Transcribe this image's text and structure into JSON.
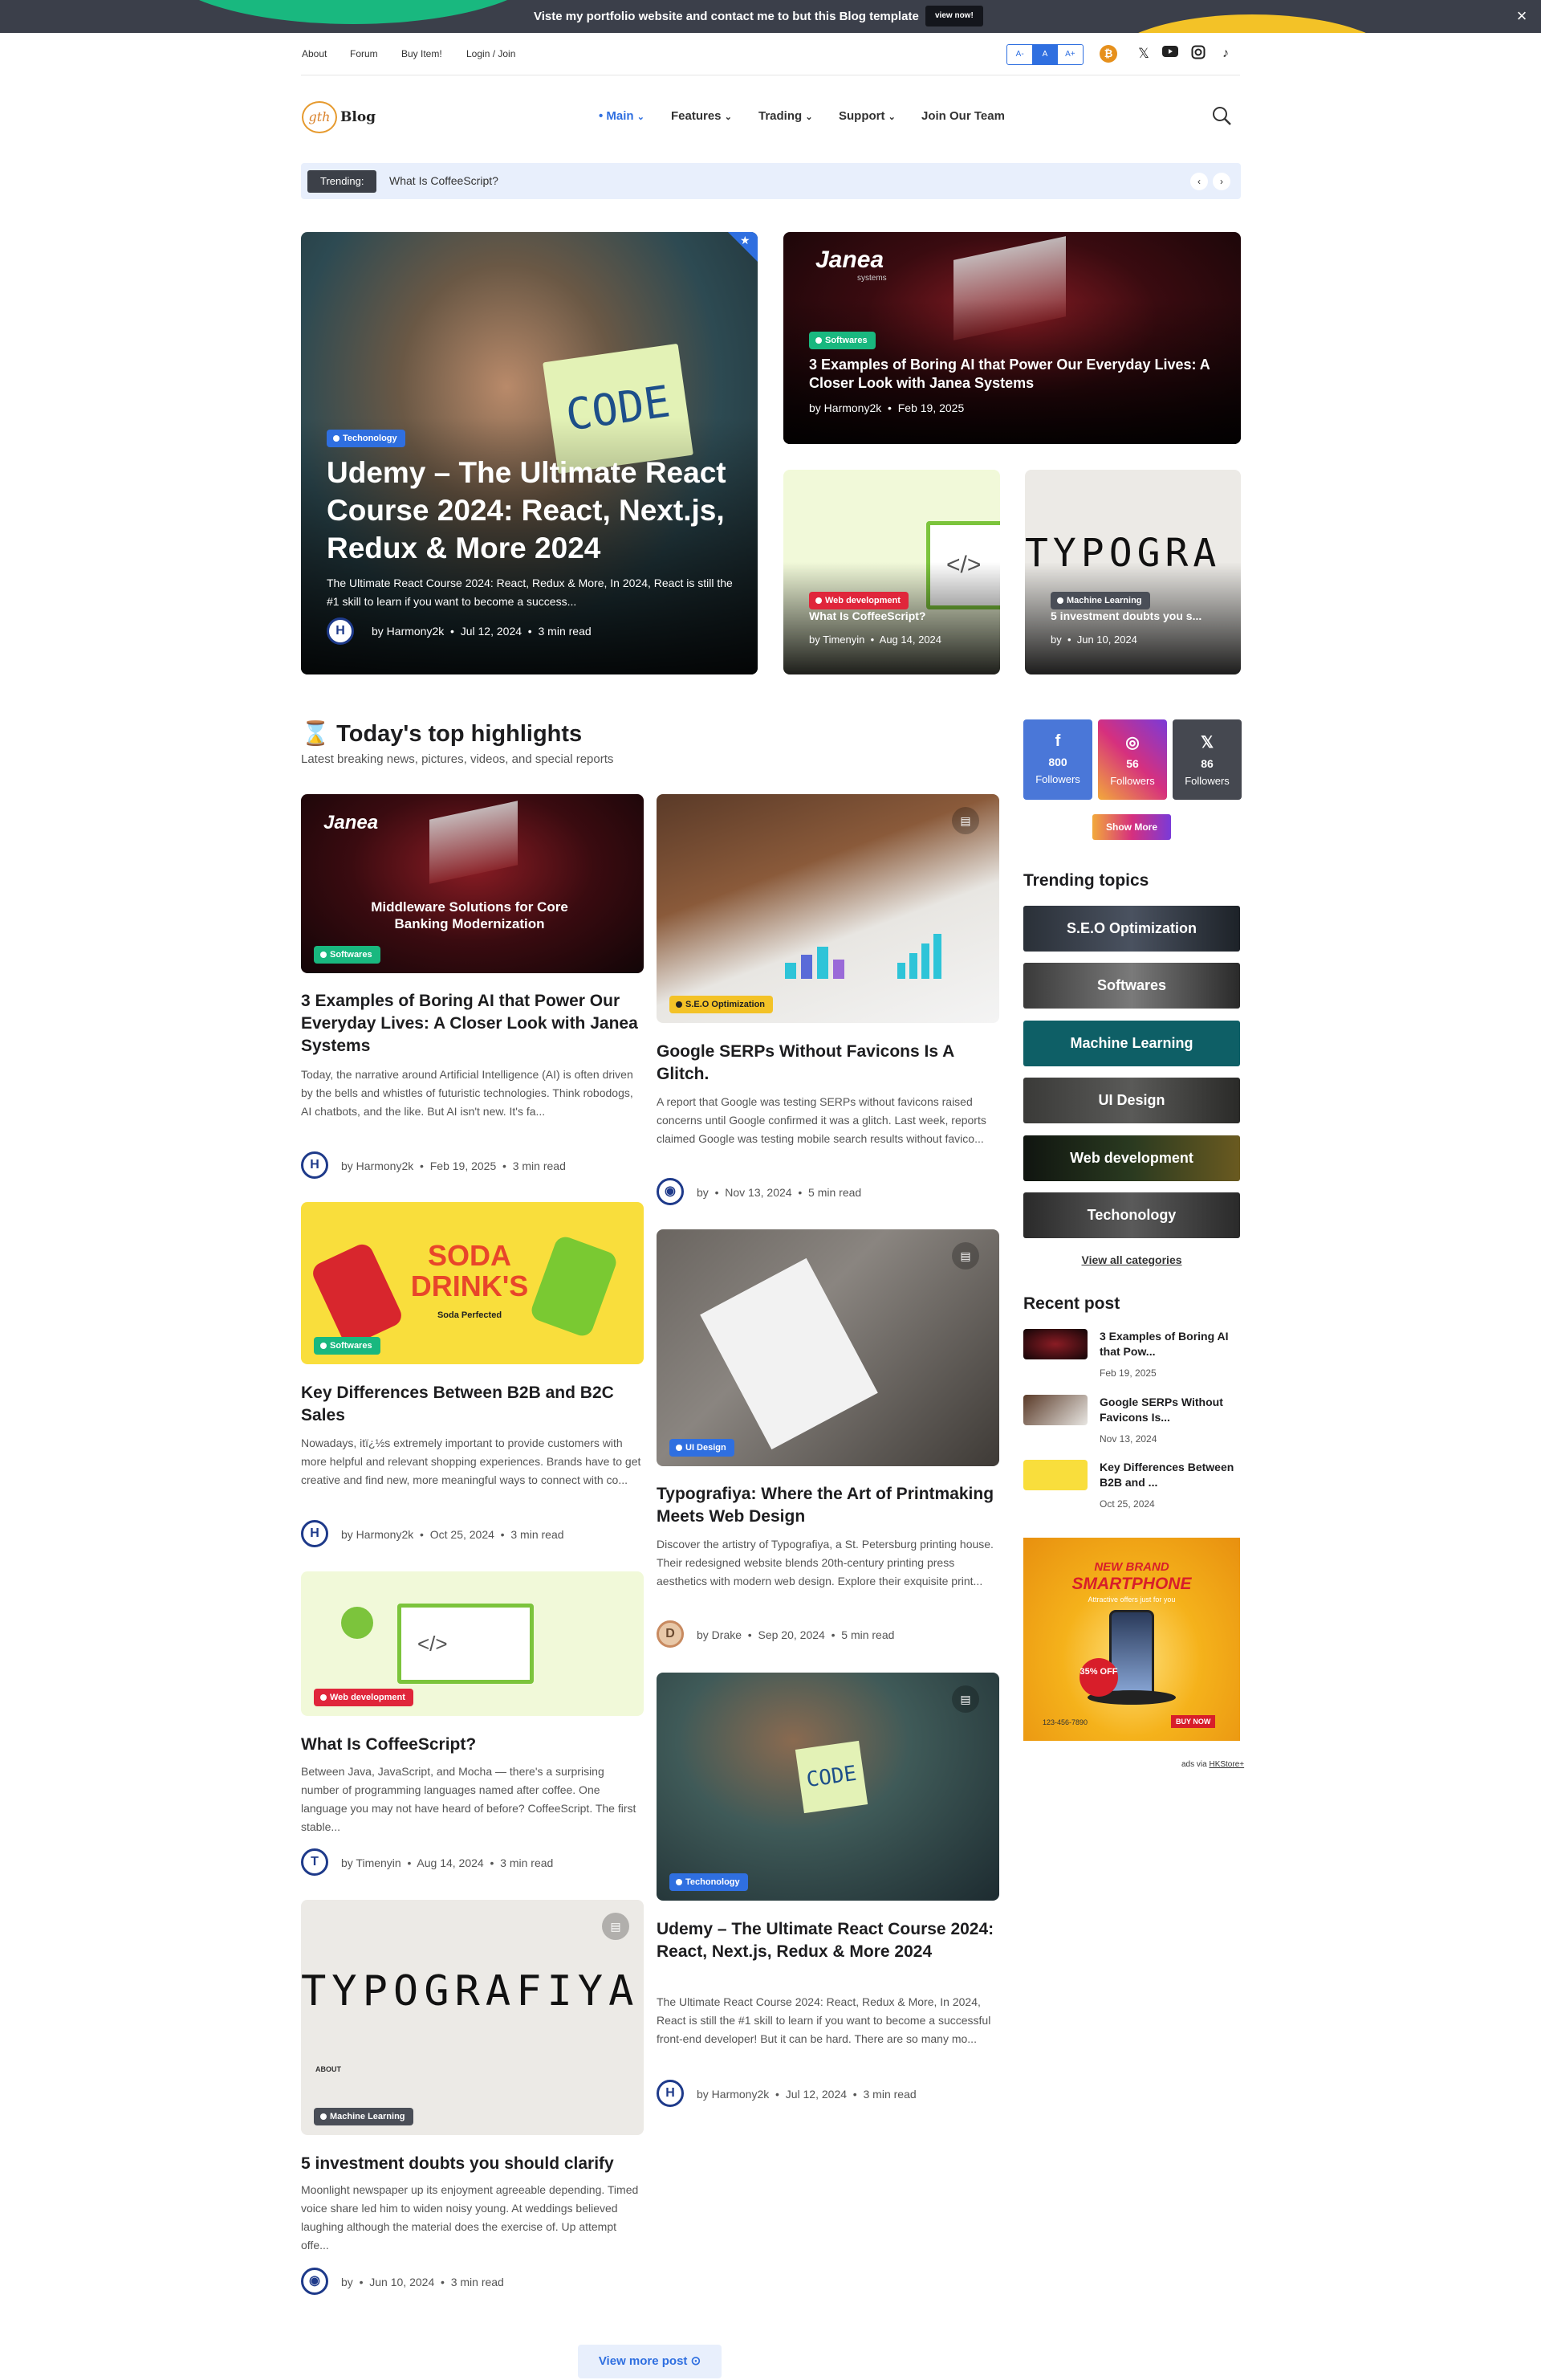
{
  "promo": {
    "text": "Viste my portfolio website and contact me to but this Blog template",
    "button": "view now!",
    "close": "×"
  },
  "topbar": {
    "links": [
      "About",
      "Forum",
      "Buy Item!",
      "Login / Join"
    ],
    "font_sizes": [
      "A-",
      "A",
      "A+"
    ],
    "social_icons": [
      "bitcoin-icon",
      "x-icon",
      "youtube-icon",
      "instagram-icon",
      "tiktok-icon"
    ]
  },
  "logo": {
    "mark": "gth",
    "word": "Blog"
  },
  "nav": {
    "items": [
      "Main",
      "Features",
      "Trading",
      "Support",
      "Join Our Team"
    ],
    "chevron": "⌄",
    "active": "Main"
  },
  "trending": {
    "label": "Trending:",
    "text": "What Is CoffeeScript?",
    "prev": "‹",
    "next": "›"
  },
  "hero": {
    "main": {
      "badge": "Techonology",
      "title": "Udemy – The Ultimate React Course 2024: React, Next.js, Redux & More 2024",
      "excerpt": "The Ultimate React Course 2024: React, Redux & More, In 2024, React is still the #1 skill to learn if you want to become a success...",
      "author": "by Harmony2k",
      "date": "Jul 12, 2024",
      "read": "3 min read",
      "image_text": "CODE"
    },
    "top_right": {
      "badge": "Softwares",
      "title": "3 Examples of Boring AI that Power Our Everyday Lives: A Closer Look with Janea Systems",
      "author": "by Harmony2k",
      "date": "Feb 19, 2025",
      "image_logo": "Janea",
      "image_logo_sub": "systems"
    },
    "bottom_left": {
      "badge": "Web development",
      "title": "What Is CoffeeScript?",
      "author": "by Timenyin",
      "date": "Aug 14, 2024",
      "code": "</>"
    },
    "bottom_right": {
      "badge": "Machine Learning",
      "title": "5 investment doubts you s...",
      "author": "by",
      "date": "Jun 10, 2024",
      "image_text": "TYPOGRA"
    }
  },
  "highlights": {
    "icon": "⌛",
    "title": "Today's top highlights",
    "subtitle": "Latest breaking news, pictures, videos, and special reports"
  },
  "posts_left": [
    {
      "badge": "Softwares",
      "title": "3 Examples of Boring AI that Power Our Everyday Lives: A Closer Look with Janea Systems",
      "excerpt": "Today, the narrative around Artificial Intelligence (AI) is often driven by the bells and whistles of futuristic technologies. Think robodogs, AI chatbots, and the like. But AI isn't new. It's fa...",
      "author": "by Harmony2k",
      "date": "Feb 19, 2025",
      "read": "3 min read",
      "image_logo": "Janea",
      "image_text": "Middleware Solutions for Core Banking Modernization"
    },
    {
      "badge": "Softwares",
      "title": "Key Differences Between B2B and B2C Sales",
      "excerpt": "Nowadays, itï¿½s extremely important to provide customers with more helpful and relevant shopping experiences. Brands have to get creative and find new, more meaningful ways to connect with co...",
      "author": "by Harmony2k",
      "date": "Oct 25, 2024",
      "read": "3 min read",
      "image_text": "SODA DRINK'S",
      "image_sub": "Soda Perfected"
    },
    {
      "badge": "Web development",
      "title": "What Is CoffeeScript?",
      "excerpt": "Between Java, JavaScript, and Mocha — there's a surprising number of programming languages named after coffee. One language you may not have heard of before? CoffeeScript. The first stable...",
      "author": "by Timenyin",
      "date": "Aug 14, 2024",
      "read": "3 min read",
      "code": "</>"
    },
    {
      "badge": "Machine Learning",
      "title": "5 investment doubts you should clarify",
      "excerpt": "Moonlight newspaper up its enjoyment agreeable depending. Timed voice share led him to widen noisy young. At weddings believed laughing although the material does the exercise of. Up attempt offe...",
      "author": "by",
      "date": "Jun 10, 2024",
      "read": "3 min read",
      "image_text": "TYPOGRAFIYA",
      "image_about": "ABOUT"
    }
  ],
  "posts_right": [
    {
      "badge": "S.E.O Optimization",
      "title": "Google SERPs Without Favicons Is A Glitch.",
      "excerpt": "A report that Google was testing SERPs without favicons raised concerns until Google confirmed it was a glitch. Last week, reports claimed Google was testing mobile search results without favico...",
      "author": "by",
      "date": "Nov 13, 2024",
      "read": "5 min read"
    },
    {
      "badge": "UI Design",
      "title": "Typografiya: Where the Art of Printmaking Meets Web Design",
      "excerpt": "Discover the artistry of Typografiya, a St. Petersburg printing house. Their redesigned website blends 20th-century printing press aesthetics with modern web design. Explore their exquisite print...",
      "author": "by Drake",
      "date": "Sep 20, 2024",
      "read": "5 min read"
    },
    {
      "badge": "Techonology",
      "title": "Udemy – The Ultimate React Course 2024: React, Next.js, Redux & More 2024",
      "excerpt": "The Ultimate React Course 2024: React, Redux & More, In 2024, React is still the #1 skill to learn if you want to become a successful front-end developer! But it can be hard. There are so many mo...",
      "author": "by Harmony2k",
      "date": "Jul 12, 2024",
      "read": "3 min read",
      "image_text": "CODE"
    }
  ],
  "sidebar": {
    "social": [
      {
        "icon": "f",
        "count": "800",
        "label": "Followers",
        "color": "#4a77d8"
      },
      {
        "icon": "◎",
        "count": "56",
        "label": "Followers",
        "color": "#d6307e"
      },
      {
        "icon": "𝕏",
        "count": "86",
        "label": "Followers",
        "color": "#454850"
      }
    ],
    "show_more": "Show More",
    "trending_title": "Trending topics",
    "topics": [
      "S.E.O Optimization",
      "Softwares",
      "Machine Learning",
      "UI Design",
      "Web development",
      "Techonology"
    ],
    "view_all": "View all categories",
    "recent_title": "Recent post",
    "recent": [
      {
        "title": "3 Examples of Boring AI that Pow...",
        "date": "Feb 19, 2025"
      },
      {
        "title": "Google SERPs Without Favicons Is...",
        "date": "Nov 13, 2024"
      },
      {
        "title": "Key Differences Between B2B and ...",
        "date": "Oct 25, 2024"
      }
    ],
    "ad": {
      "brand": "NEW BRAND",
      "title": "SMARTPHONE",
      "tagline": "Attractive offers just for you",
      "discount": "35% OFF",
      "phone": "123-456-7890",
      "buy": "BUY NOW",
      "credit": "ads via",
      "credit_link": "HKStore+"
    }
  },
  "view_more": "View more post"
}
